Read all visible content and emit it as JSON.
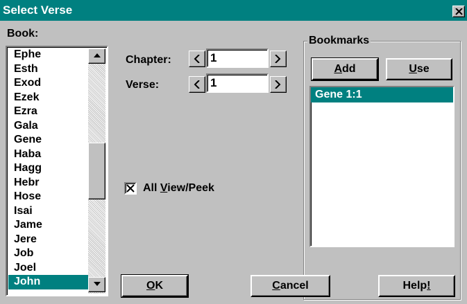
{
  "window": {
    "title": "Select Verse"
  },
  "book": {
    "label": "Book:",
    "items": [
      "Ephe",
      "Esth",
      "Exod",
      "Ezek",
      "Ezra",
      "Gala",
      "Gene",
      "Haba",
      "Hagg",
      "Hebr",
      "Hose",
      "Isai",
      "Jame",
      "Jere",
      "Job",
      "Joel",
      "John"
    ],
    "selected": "John"
  },
  "chapter": {
    "label": "Chapter:",
    "value": "1"
  },
  "verse": {
    "label": "Verse:",
    "value": "1"
  },
  "options": {
    "all_view_peek": {
      "label_pre": "All ",
      "label_u": "V",
      "label_post": "iew/Peek",
      "checked": true
    }
  },
  "bookmarks": {
    "title": "Bookmarks",
    "add_label_u": "A",
    "add_label_rest": "dd",
    "use_label_u": "U",
    "use_label_rest": "se",
    "items": [
      "Gene 1:1"
    ],
    "selected": "Gene 1:1"
  },
  "footer": {
    "ok_u": "O",
    "ok_rest": "K",
    "cancel_u": "C",
    "cancel_rest": "ancel",
    "help_pre": "Help",
    "help_u": "!"
  },
  "colors": {
    "titlebar": "#008080",
    "selection": "#008080",
    "face": "#c0c0c0"
  }
}
